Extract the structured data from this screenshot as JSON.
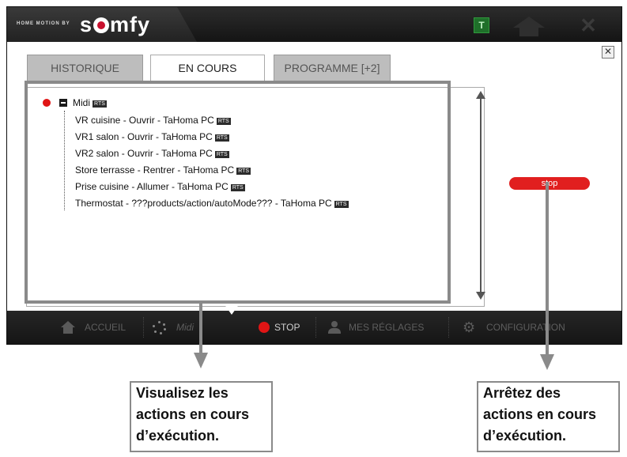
{
  "brand": {
    "tagline": "HOME MOTION BY",
    "logo_text": "somfy"
  },
  "topbar": {
    "t_label": "T"
  },
  "tabs": [
    {
      "label": "HISTORIQUE"
    },
    {
      "label": "EN COURS"
    },
    {
      "label": "PROGRAMME [+2]"
    }
  ],
  "tree": {
    "root": {
      "label": "Midi",
      "tag": "RTS"
    },
    "actions": [
      {
        "label": "VR cuisine - Ouvrir - TaHoma PC",
        "tag": "RTS"
      },
      {
        "label": "VR1 salon - Ouvrir - TaHoma PC",
        "tag": "RTS"
      },
      {
        "label": "VR2 salon - Ouvrir - TaHoma PC",
        "tag": "RTS"
      },
      {
        "label": "Store terrasse - Rentrer - TaHoma PC",
        "tag": "RTS"
      },
      {
        "label": "Prise cuisine - Allumer - TaHoma PC",
        "tag": "RTS"
      },
      {
        "label": "Thermostat - ???products/action/autoMode??? - TaHoma PC",
        "tag": "RTS"
      }
    ]
  },
  "stop_button": "stop",
  "nav": {
    "accueil": "ACCUEIL",
    "midi": "Midi",
    "stop": "STOP",
    "reglages": "MES RÉGLAGES",
    "configuration": "CONFIGURATION"
  },
  "callouts": {
    "left": [
      "Visualisez les",
      "actions en cours",
      "d’exécution."
    ],
    "right": [
      "Arrêtez des",
      "actions en cours",
      "d’exécution."
    ]
  },
  "colors": {
    "accent_red": "#e01515",
    "annotation_gray": "#8a8a8a",
    "toolbar_bg": "#1f1f1f"
  }
}
